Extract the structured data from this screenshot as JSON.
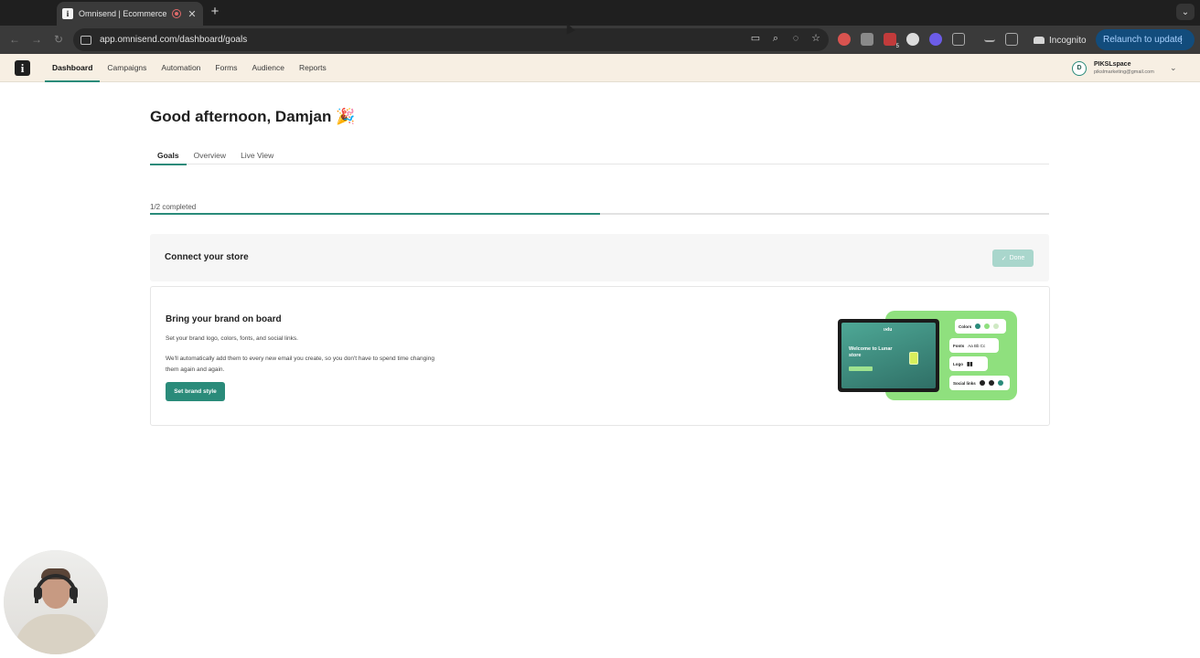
{
  "browser": {
    "tab_title": "Omnisend | Ecommerce M",
    "new_tab_symbol": "+",
    "close_symbol": "✕",
    "url": "app.omnisend.com/dashboard/goals",
    "incognito_label": "Incognito",
    "relaunch_label": "Relaunch to update",
    "extension_badge": "5"
  },
  "header": {
    "logo_letter": "i",
    "nav": [
      {
        "label": "Dashboard",
        "active": true
      },
      {
        "label": "Campaigns"
      },
      {
        "label": "Automation"
      },
      {
        "label": "Forms"
      },
      {
        "label": "Audience"
      },
      {
        "label": "Reports"
      }
    ],
    "account": {
      "initial": "D",
      "name": "PIKSLspace",
      "email": "pikslmarketing@gmail.com"
    }
  },
  "page": {
    "greeting": "Good afternoon, Damjan 🎉",
    "tabs": [
      {
        "label": "Goals",
        "active": true
      },
      {
        "label": "Overview"
      },
      {
        "label": "Live View"
      }
    ],
    "progress": {
      "label": "1/2 completed",
      "completed": 1,
      "total": 2,
      "fraction": 0.5
    },
    "goals": [
      {
        "title": "Connect your store",
        "status_label": "Done"
      },
      {
        "title": "Bring your brand on board",
        "description_1": "Set your brand logo, colors, fonts, and social links.",
        "description_2": "We'll automatically add them to every new email you create, so you don't have to spend time changing them again and again.",
        "button_label": "Set brand style",
        "illustration": {
          "tablet_brand": "אוlu",
          "tablet_title": "Welcome to Lunar store",
          "pills": [
            "Colors",
            "Fonts",
            "Logo",
            "Social links"
          ],
          "font_sample": "Aa Bb Cc",
          "swatch_colors": [
            "#2a8b7a",
            "#8fe07e",
            "#cfe9c4"
          ]
        }
      }
    ]
  },
  "colors": {
    "accent": "#2a8b7a",
    "header_bg": "#f7efe3",
    "done_button": "#a9d6cc"
  }
}
